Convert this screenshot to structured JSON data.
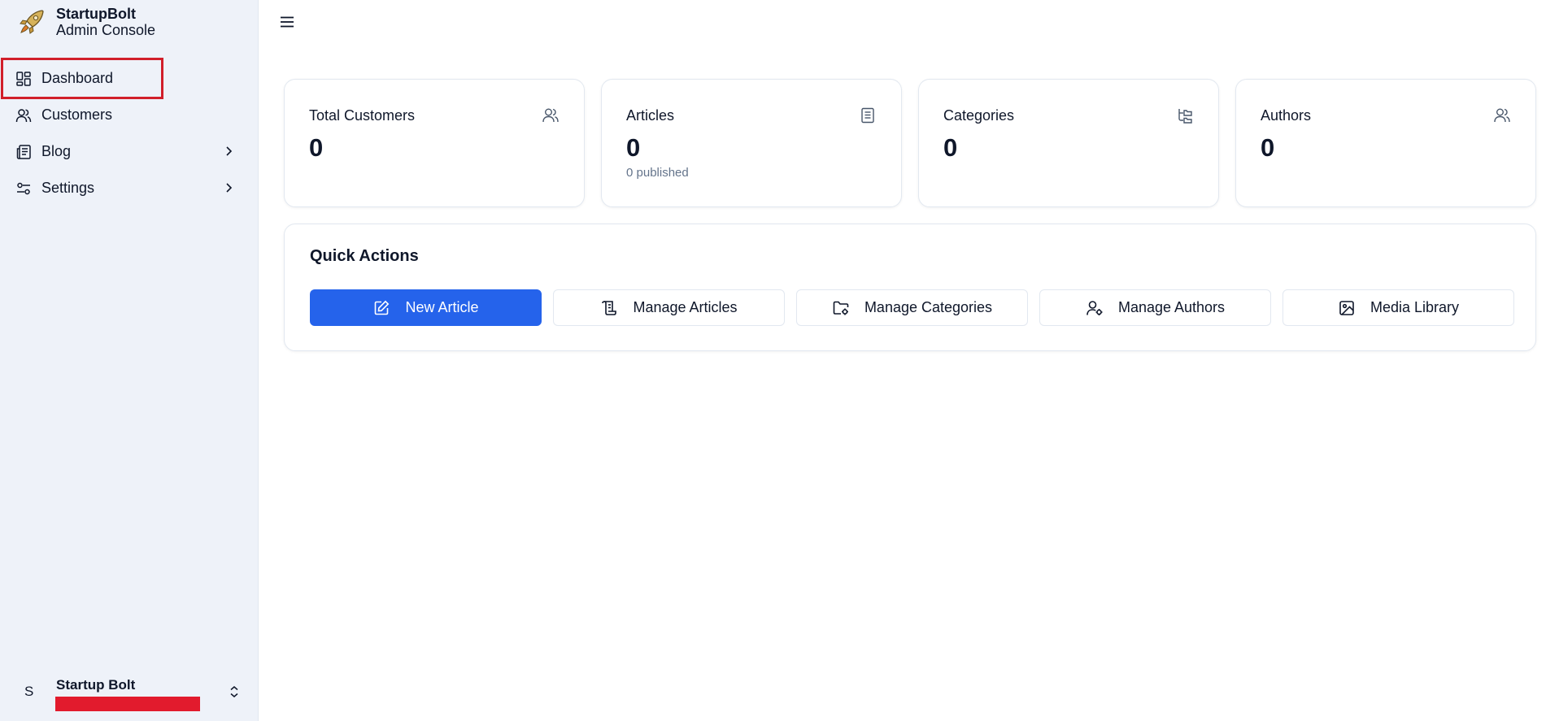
{
  "brand": {
    "name": "StartupBolt",
    "subtitle": "Admin Console",
    "logo_icon": "rocket-icon"
  },
  "sidebar": {
    "items": [
      {
        "label": "Dashboard",
        "icon": "dashboard-icon",
        "active": true
      },
      {
        "label": "Customers",
        "icon": "users-icon"
      },
      {
        "label": "Blog",
        "icon": "newspaper-icon",
        "has_submenu": true
      },
      {
        "label": "Settings",
        "icon": "sliders-icon",
        "has_submenu": true
      }
    ],
    "user": {
      "avatar_initial": "S",
      "name": "Startup Bolt"
    }
  },
  "stats": [
    {
      "title": "Total Customers",
      "value": "0",
      "icon": "users-icon"
    },
    {
      "title": "Articles",
      "value": "0",
      "sub": "0 published",
      "icon": "document-icon"
    },
    {
      "title": "Categories",
      "value": "0",
      "icon": "folder-tree-icon"
    },
    {
      "title": "Authors",
      "value": "0",
      "icon": "users-icon"
    }
  ],
  "quick_actions": {
    "title": "Quick Actions",
    "buttons": [
      {
        "label": "New Article",
        "icon": "edit-icon",
        "primary": true
      },
      {
        "label": "Manage Articles",
        "icon": "scroll-icon"
      },
      {
        "label": "Manage Categories",
        "icon": "folder-gear-icon"
      },
      {
        "label": "Manage Authors",
        "icon": "user-gear-icon"
      },
      {
        "label": "Media Library",
        "icon": "image-icon"
      }
    ]
  },
  "colors": {
    "primary": "#2563eb",
    "sidebar_bg": "#eef2f9",
    "highlight": "#d11f2a",
    "redaction": "#e21b2d"
  }
}
